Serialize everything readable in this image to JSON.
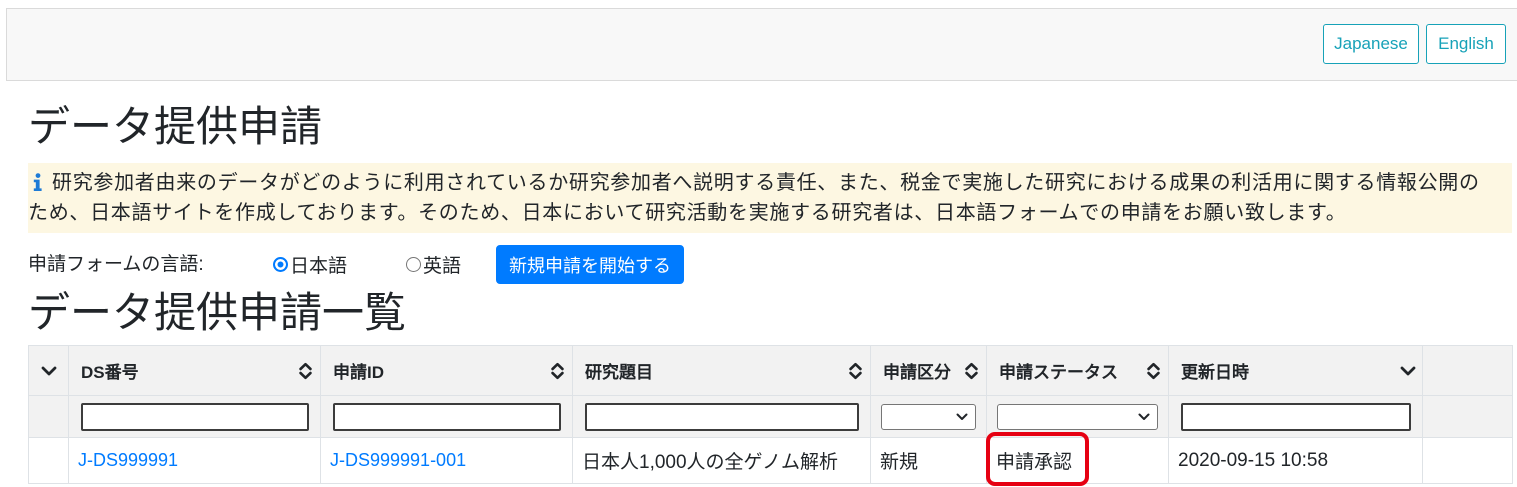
{
  "colors": {
    "accent": "#007bff",
    "teal": "#17a2b8",
    "header_bg": "#f8f8f8",
    "info_bg": "#fdf7e2",
    "table_header_bg": "#f2f2f2",
    "highlight": "#e60012"
  },
  "header": {
    "lang_buttons": [
      {
        "label": "Japanese"
      },
      {
        "label": "English"
      }
    ]
  },
  "page_title": "データ提供申請",
  "notice": {
    "icon": "info-icon",
    "lines": [
      "研究参加者由来のデータがどのように利用されているか研究参加者へ説明する責任、また、税金で実施した研究における成果の利活用に関する情報公開の",
      "ため、日本語サイトを作成しております。そのため、日本において研究活動を実施する研究者は、日本語フォームでの申請をお願い致します。"
    ]
  },
  "form_language": {
    "label": "申請フォームの言語:",
    "options": [
      {
        "label": "日本語",
        "checked": true
      },
      {
        "label": "英語",
        "checked": false
      }
    ],
    "start_button": "新規申請を開始する"
  },
  "list_title": "データ提供申請一覧",
  "table": {
    "expand_icon": "chevron-down-icon",
    "columns": [
      {
        "label": "DS番号",
        "icon": "sort-icon",
        "filter": "text",
        "filter_value": ""
      },
      {
        "label": "申請ID",
        "icon": "sort-icon",
        "filter": "text",
        "filter_value": ""
      },
      {
        "label": "研究題目",
        "icon": "sort-icon",
        "filter": "text",
        "filter_value": ""
      },
      {
        "label": "申請区分",
        "icon": "sort-icon",
        "filter": "select",
        "filter_value": ""
      },
      {
        "label": "申請ステータス",
        "icon": "sort-icon",
        "filter": "select",
        "filter_value": ""
      },
      {
        "label": "更新日時",
        "icon": "chevron-down-icon",
        "filter": "text",
        "filter_value": ""
      }
    ],
    "rows": [
      {
        "ds_number": "J-DS999991",
        "application_id": "J-DS999991-001",
        "title": "日本人1,000人の全ゲノム解析",
        "category": "新規",
        "status": "申請承認",
        "updated": "2020-09-15 10:58"
      }
    ]
  }
}
